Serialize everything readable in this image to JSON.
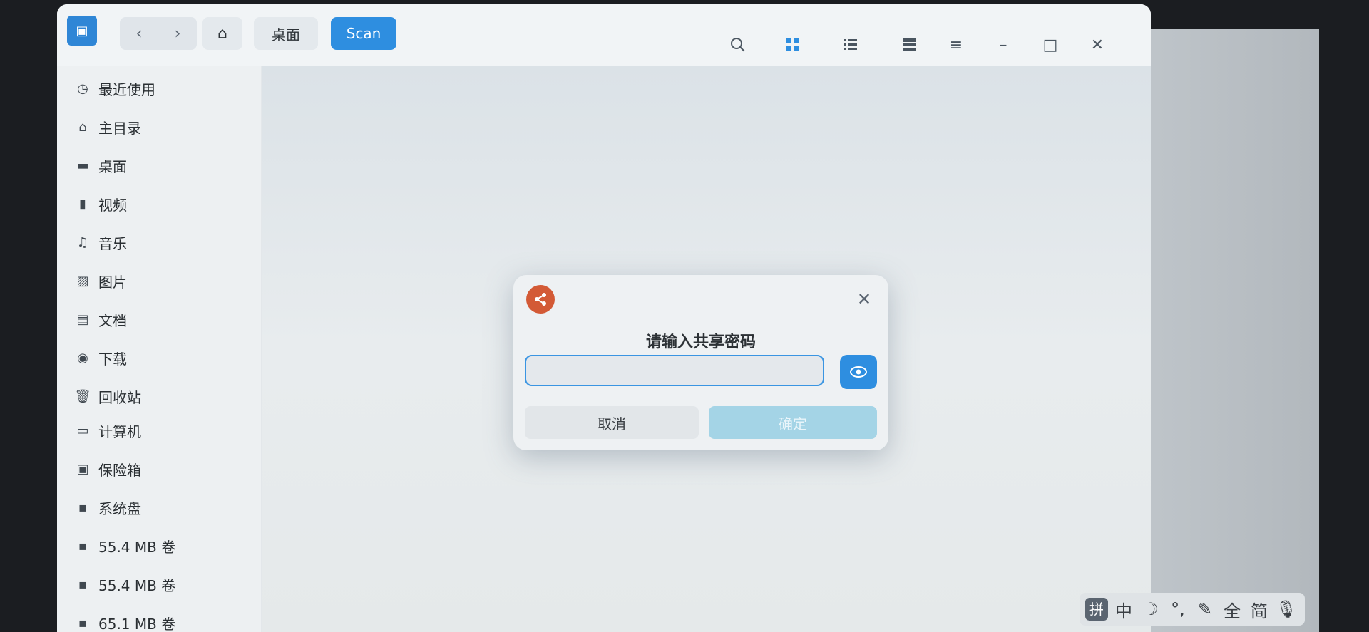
{
  "titlebar": {
    "app_icon": "file-manager-icon",
    "nav_back": "‹",
    "nav_forward": "›",
    "home_glyph": "⌂",
    "breadcrumbs": [
      "桌面",
      "Scan"
    ],
    "toolbar_icons": [
      "search-icon",
      "grid-view-icon",
      "list-view-icon",
      "detail-view-icon",
      "menu-icon",
      "minimize-icon",
      "maximize-icon",
      "close-icon"
    ]
  },
  "sidebar": {
    "items": [
      {
        "label": "最近使用",
        "icon": "clock-icon"
      },
      {
        "label": "主目录",
        "icon": "home-icon"
      },
      {
        "label": "桌面",
        "icon": "desktop-icon"
      },
      {
        "label": "视频",
        "icon": "video-icon"
      },
      {
        "label": "音乐",
        "icon": "music-icon"
      },
      {
        "label": "图片",
        "icon": "image-icon"
      },
      {
        "label": "文档",
        "icon": "document-icon"
      },
      {
        "label": "下载",
        "icon": "download-icon"
      },
      {
        "label": "回收站",
        "icon": "trash-icon"
      }
    ],
    "devices": [
      {
        "label": "计算机",
        "icon": "computer-icon"
      },
      {
        "label": "保险箱",
        "icon": "safe-icon"
      },
      {
        "label": "系统盘",
        "icon": "disk-icon"
      },
      {
        "label": "55.4 MB 卷",
        "icon": "disk-icon"
      },
      {
        "label": "55.4 MB 卷",
        "icon": "disk-icon"
      },
      {
        "label": "65.1 MB 卷",
        "icon": "disk-icon"
      }
    ]
  },
  "dialog": {
    "title": "请输入共享密码",
    "password_value": "",
    "cancel_label": "取消",
    "ok_label": "确定"
  },
  "ime": {
    "items": [
      "拼",
      "中",
      "☽",
      "°,",
      "✎",
      "全",
      "简",
      "🎙"
    ]
  },
  "colors": {
    "accent": "#2e8ee0",
    "share_icon": "#d35a36",
    "ok_disabled": "#a4d4e6"
  }
}
